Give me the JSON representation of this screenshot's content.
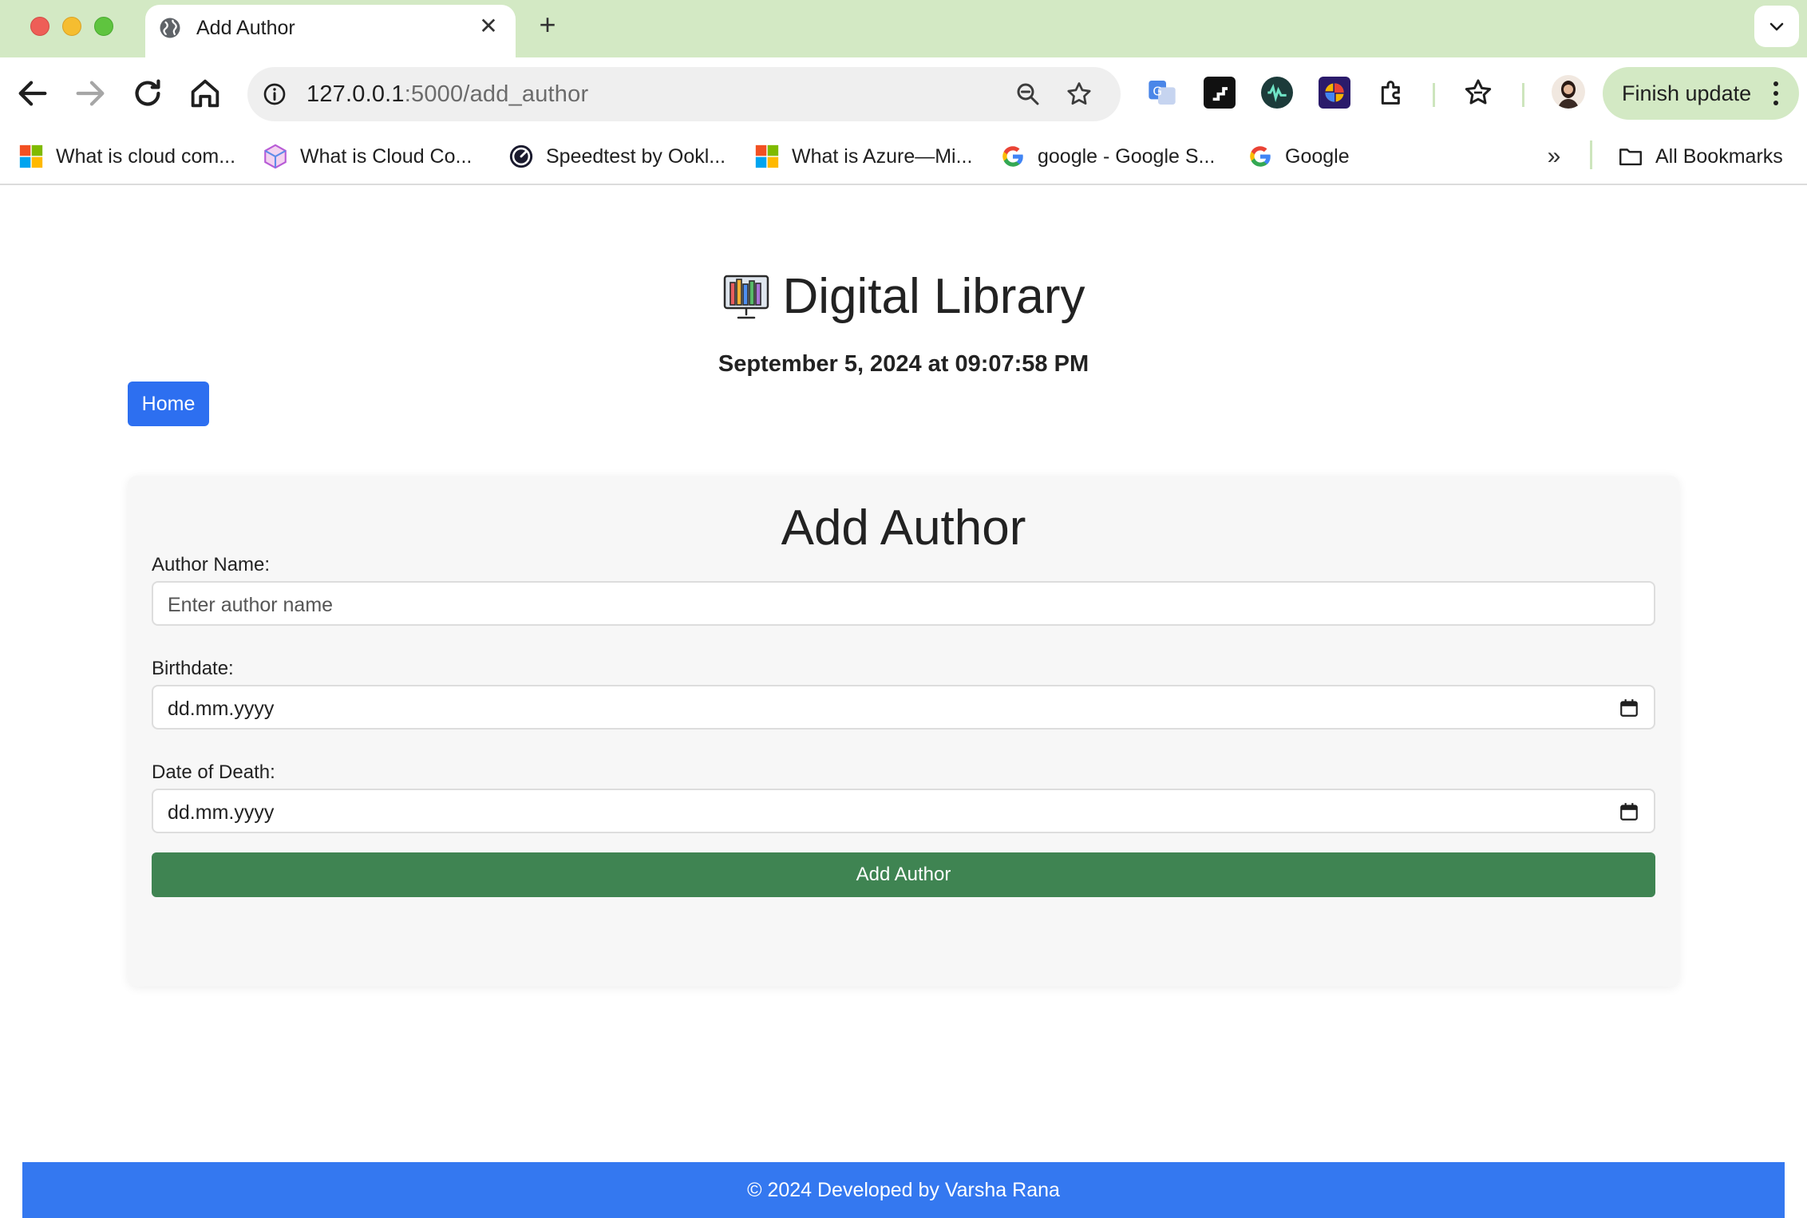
{
  "browser": {
    "tab_title": "Add Author",
    "url_host": "127.0.0.1",
    "url_path": ":5000/add_author",
    "finish_update_label": "Finish update",
    "bookmarks": [
      {
        "label": "What is cloud com...",
        "icon": "microsoft-icon"
      },
      {
        "label": "What is Cloud Co...",
        "icon": "cube-icon"
      },
      {
        "label": "Speedtest by Ookl...",
        "icon": "speedtest-icon"
      },
      {
        "label": "What is Azure—Mi...",
        "icon": "microsoft-icon"
      },
      {
        "label": "google - Google S...",
        "icon": "google-icon"
      },
      {
        "label": "Google",
        "icon": "google-icon"
      }
    ],
    "all_bookmarks_label": "All Bookmarks"
  },
  "header": {
    "title": "Digital Library",
    "datetime": "September 5, 2024 at 09:07:58 PM",
    "home_label": "Home"
  },
  "form": {
    "title": "Add Author",
    "author_name_label": "Author Name:",
    "author_name_placeholder": "Enter author name",
    "birthdate_label": "Birthdate:",
    "birthdate_value": "dd.mm.yyyy",
    "death_label": "Date of Death:",
    "death_value": "dd.mm.yyyy",
    "submit_label": "Add Author"
  },
  "footer": {
    "text": "© 2024 Developed by Varsha Rana"
  },
  "colors": {
    "tabbar": "#d3e9c4",
    "home_button": "#2d6ff0",
    "submit_button": "#3f8452",
    "footer": "#3478f0"
  }
}
